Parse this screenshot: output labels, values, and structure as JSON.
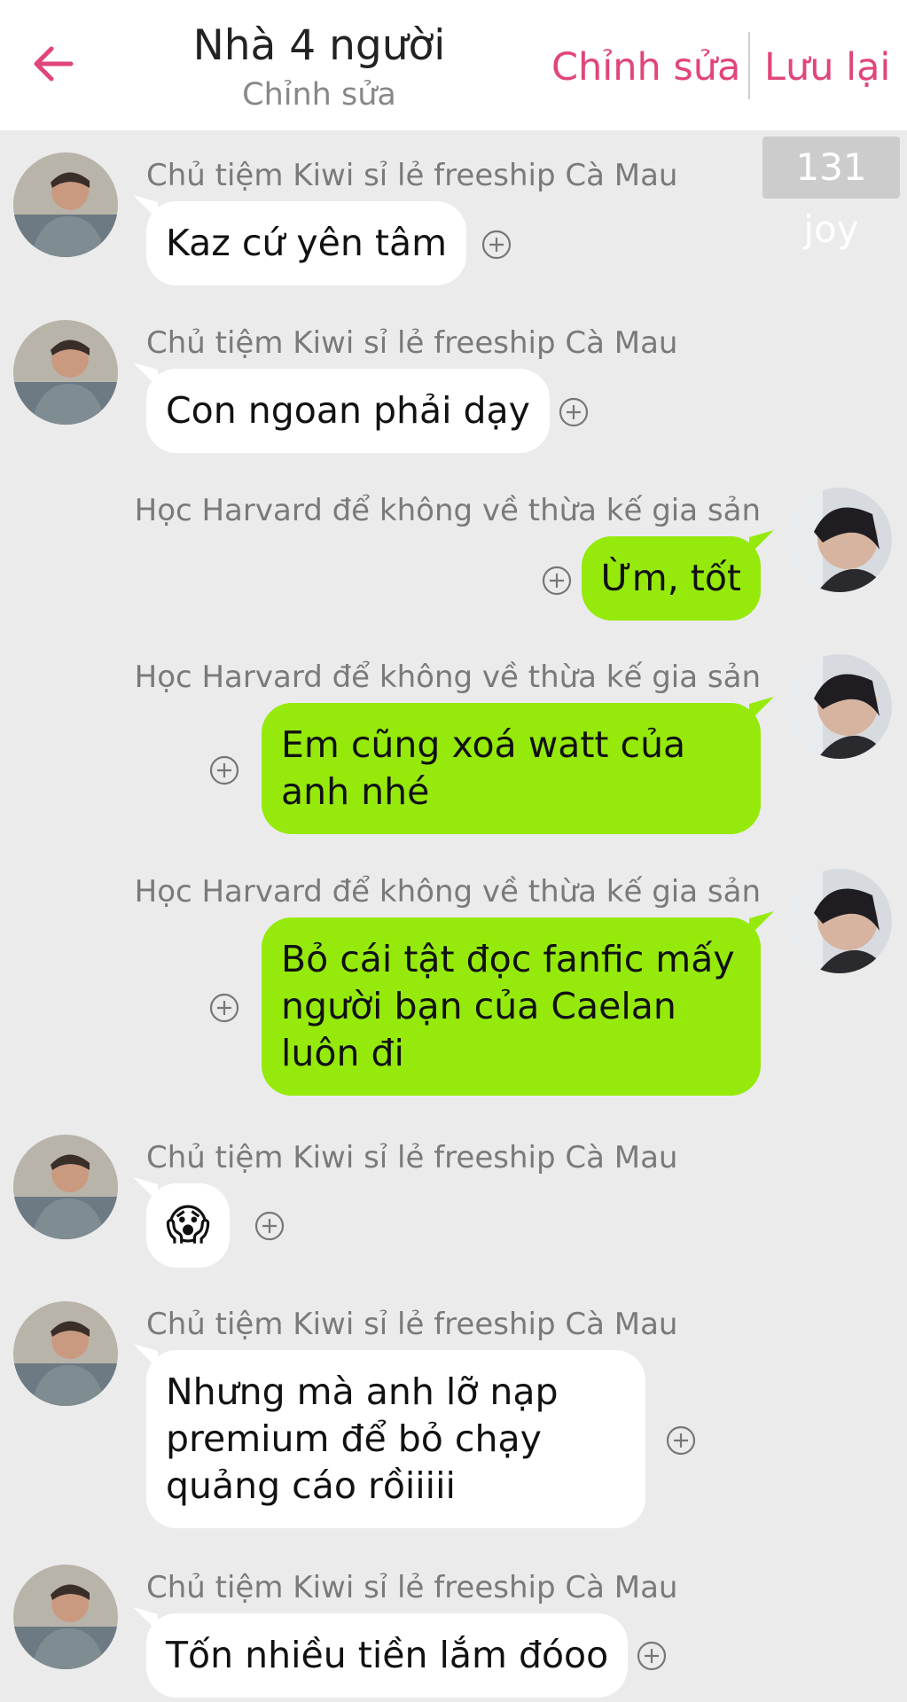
{
  "header": {
    "title": "Nhà 4 người",
    "subtitle": "Chỉnh sửa",
    "edit_label": "Chỉnh sửa",
    "save_label": "Lưu lại",
    "back_icon": "arrow-left-icon",
    "accent_color": "#e0457b"
  },
  "counter": "131 joy",
  "colors": {
    "background": "#ebebeb",
    "incoming_bubble": "#ffffff",
    "outgoing_bubble": "#95ea0c"
  },
  "messages": [
    {
      "side": "left",
      "sender": "Chủ tiệm Kiwi sỉ lẻ freeship Cà Mau",
      "text": "Kaz cứ yên tâm"
    },
    {
      "side": "left",
      "sender": "Chủ tiệm Kiwi sỉ lẻ freeship Cà Mau",
      "text": "Con ngoan phải dạy"
    },
    {
      "side": "right",
      "sender": "Học Harvard để không về thừa kế gia sản",
      "text": "Ừm, tốt"
    },
    {
      "side": "right",
      "sender": "Học Harvard để không về thừa kế gia sản",
      "text": "Em cũng xoá watt của anh nhé"
    },
    {
      "side": "right",
      "sender": "Học Harvard để không về thừa kế gia sản",
      "text": "Bỏ cái tật đọc fanfic mấy người bạn của Caelan luôn đi"
    },
    {
      "side": "left",
      "sender": "Chủ tiệm Kiwi sỉ lẻ freeship Cà Mau",
      "text": "😱"
    },
    {
      "side": "left",
      "sender": "Chủ tiệm Kiwi sỉ lẻ freeship Cà Mau",
      "text": "Nhưng mà anh lỡ nạp premium để bỏ chạy quảng cáo rồiiiii"
    },
    {
      "side": "left",
      "sender": "Chủ tiệm Kiwi sỉ lẻ freeship Cà Mau",
      "text": "Tốn nhiều tiền lắm đóoo"
    }
  ]
}
